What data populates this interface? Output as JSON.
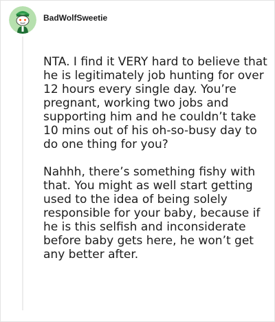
{
  "comment": {
    "username": "BadWolfSweetie",
    "paragraphs": [
      "NTA. I find it VERY hard to believe that he is legitimately job hunting for over 12 hours every single day. You’re pregnant, working two jobs and supporting him and he couldn’t take 10 mins out of his oh-so-busy day to do one thing for you?",
      "Nahhh, there’s something fishy with that. You might as well start getting used to the idea of being solely responsible for your baby, because if he is this selfish and inconsiderate before baby gets here, he won’t get any better after."
    ]
  },
  "icons": {
    "avatar": "snoo-avatar-icon"
  },
  "colors": {
    "avatar_background": "#b6e0ae",
    "username_text": "#1a1a1b",
    "body_text": "#1c1c1c",
    "thread_line": "#ececec"
  }
}
